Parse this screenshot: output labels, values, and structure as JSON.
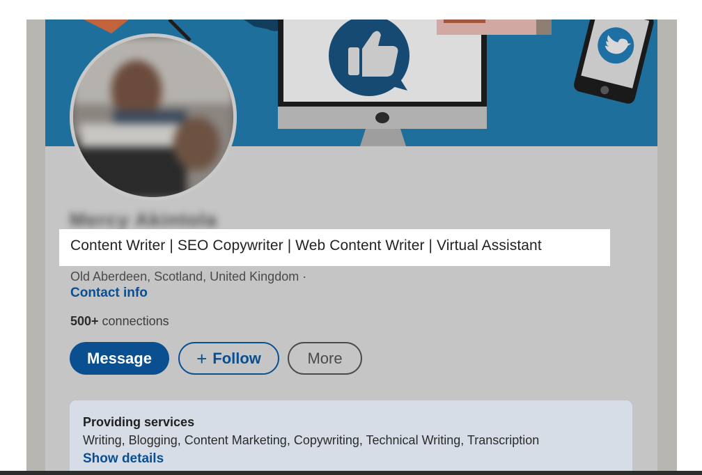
{
  "profile": {
    "name": "Mercy Akintola",
    "headline": "Content Writer | SEO Copywriter | Web Content Writer | Virtual Assistant",
    "location": "Old Aberdeen, Scotland, United Kingdom ·",
    "contact_link": "Contact info",
    "connections_count": "500+",
    "connections_label": " connections"
  },
  "actions": {
    "message_label": "Message",
    "follow_plus": "+",
    "follow_label": "Follow",
    "more_label": "More"
  },
  "services": {
    "title": "Providing services",
    "list": "Writing, Blogging, Content Marketing, Copywriting, Technical Writing, Transcription",
    "link": "Show details"
  },
  "colors": {
    "banner": "#1f6f9c",
    "link": "#0a4f91",
    "primary_button": "#0a4f8f",
    "services_background": "#d6dde6"
  },
  "icons": [
    "thumbs-up-icon",
    "twitter-bird-icon",
    "monitor-icon",
    "phone-icon"
  ]
}
